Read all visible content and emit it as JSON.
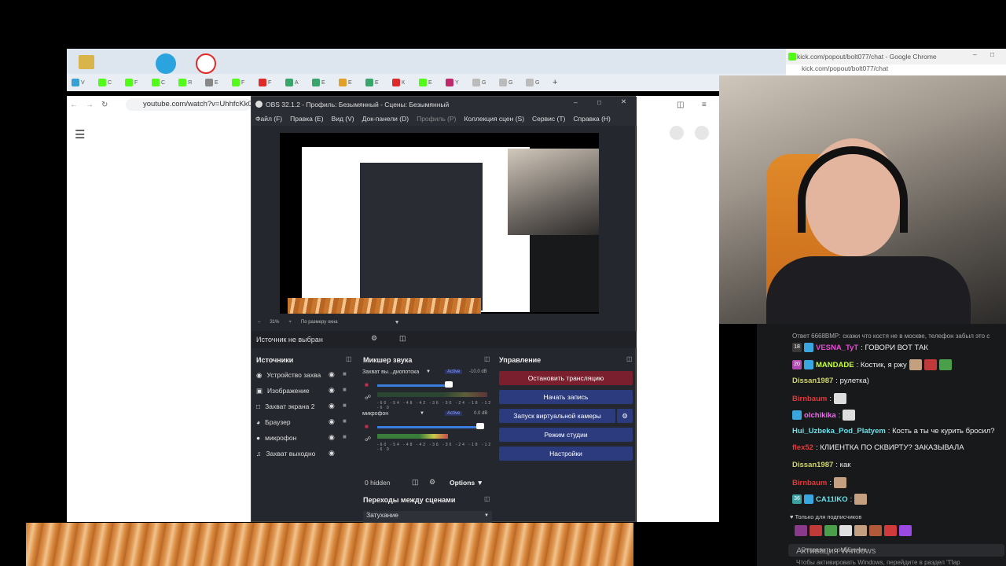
{
  "browser": {
    "url": "youtube.com/watch?v=UhhfcKk0",
    "tab_labels": [
      "V",
      "С",
      "F",
      "С",
      "Я",
      "Е",
      "F",
      "F",
      "А",
      "Е",
      "Е",
      "Е",
      "К",
      "Е",
      "Y",
      "G",
      "G",
      "G"
    ]
  },
  "obs": {
    "title": "OBS 32.1.2 - Профиль: Безымянный - Сцены: Безымянный",
    "menu": [
      "Файл (F)",
      "Правка (E)",
      "Вид (V)",
      "Док-панели (D)",
      "Профиль (P)",
      "Коллекция сцен (S)",
      "Сервис (T)",
      "Справка (H)"
    ],
    "zoom": "31%",
    "fit": "По размеру окна",
    "no_source": "Источник не выбран",
    "sources_title": "Источники",
    "sources": [
      "Устройство захва",
      "Изображение",
      "Захват экрана 2",
      "Браузер",
      "микрофон",
      "Захват выходно"
    ],
    "mixer_title": "Микшер звука",
    "mixer": [
      {
        "name": "Захват вы...диопотока",
        "status": "Active",
        "db": "-10.0 dB"
      },
      {
        "name": "микрофон",
        "status": "Active",
        "db": "0.0 dB"
      }
    ],
    "scale": "-60 -54 -48 -42 -36 -30 -24 -18 -12 -6 0",
    "hidden": "0 hidden",
    "options": "Options",
    "controls_title": "Управление",
    "controls": [
      "Остановить трансляцию",
      "Начать запись",
      "Запуск виртуальной камеры",
      "Режим студии",
      "Настройки"
    ],
    "transitions_title": "Переходы между сценами",
    "transition": "Затухание"
  },
  "kick": {
    "window_title": "kick.com/popout/bolt077/chat - Google Chrome",
    "url": "kick.com/popout/bolt077/chat",
    "messages": [
      {
        "user": "Ответ 6668ВМР:",
        "text": "скажи что костя не в москве, телефон забыл это с",
        "color": "#aaaaaa",
        "badge": ""
      },
      {
        "user": "VESNA_TyT",
        "text": ": ГОВОРИ ВОТ ТАК",
        "color": "#e84ad4",
        "badge": "18"
      },
      {
        "user": "MANDADE",
        "text": ": Костик, я ржу",
        "color": "#c8ff3a",
        "badge": "20"
      },
      {
        "user": "Dissan1987",
        "text": ": рулетка)",
        "color": "#cfd46a",
        "badge": ""
      },
      {
        "user": "Birnbaum",
        "text": ":",
        "color": "#e03a3a",
        "badge": ""
      },
      {
        "user": "olchikika",
        "text": ":",
        "color": "#e870e8",
        "badge": ""
      },
      {
        "user": "Hui_Uzbeka_Pod_Platyem",
        "text": ": Кость а ты че курить бросил?",
        "color": "#6ae0e8",
        "badge": ""
      },
      {
        "user": "flex52",
        "text": ": КЛИЕНТКА ПО СКВИРТУ? ЗАКАЗЫВАЛА",
        "color": "#e03a3a",
        "badge": ""
      },
      {
        "user": "Dissan1987",
        "text": ": как",
        "color": "#cfd46a",
        "badge": ""
      },
      {
        "user": "Birnbaum",
        "text": ":",
        "color": "#e03a3a",
        "badge": ""
      },
      {
        "user": "CA11IKO",
        "text": ":",
        "color": "#6ae0e8",
        "badge": "36"
      }
    ],
    "subs_only": "Только для подписчиков",
    "input_placeholder": "Отправить сообщение",
    "activation_title": "Активация Windows",
    "activation_text": "Чтобы активировать Windows, перейдите в раздел \"Пар"
  }
}
